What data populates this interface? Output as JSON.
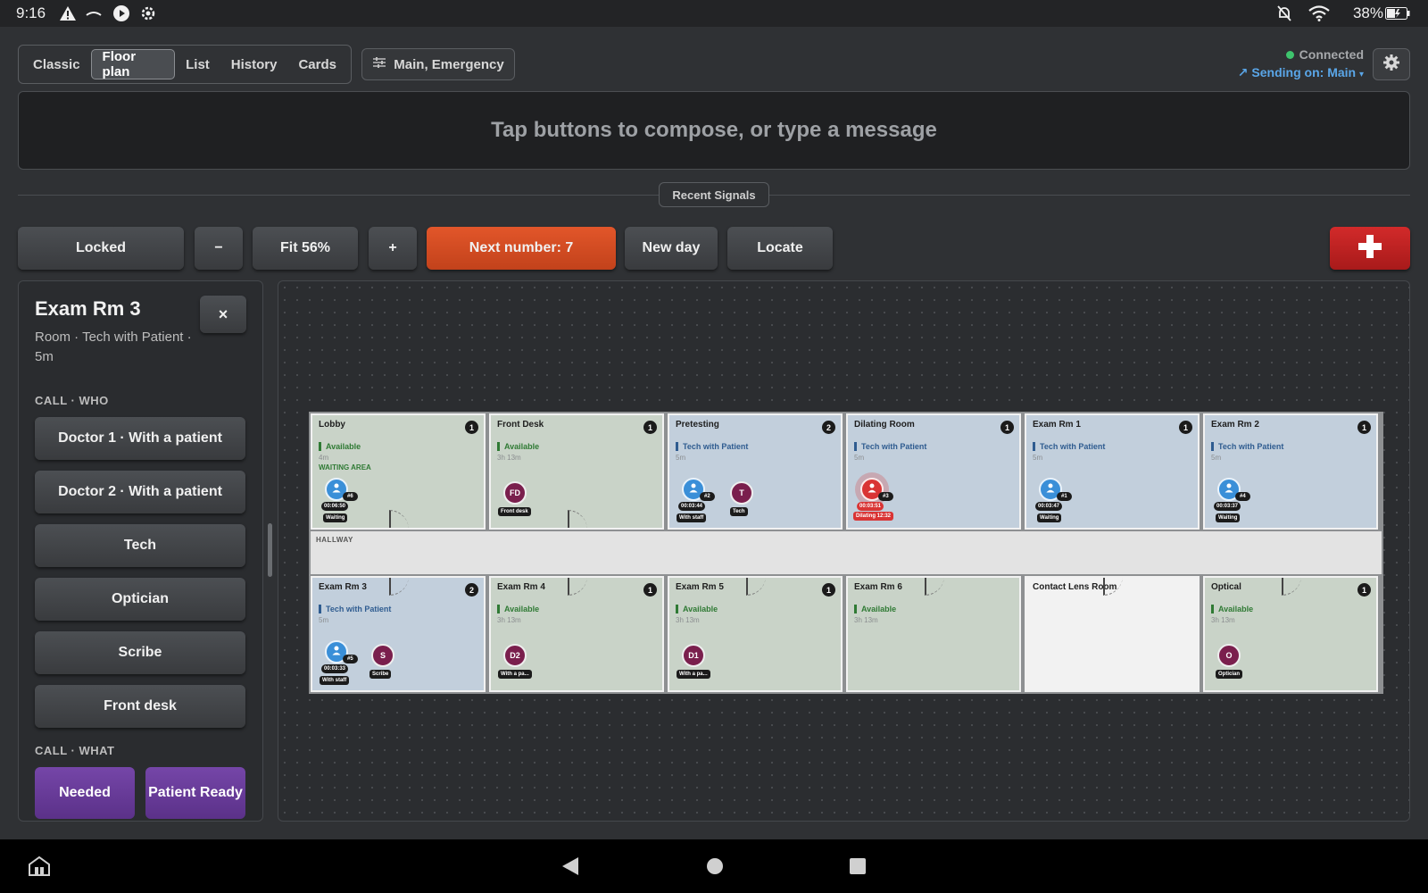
{
  "status_bar": {
    "time": "9:16",
    "battery": "38%"
  },
  "tabs": [
    {
      "label": "Classic",
      "active": false
    },
    {
      "label": "Floor plan",
      "active": true
    },
    {
      "label": "List",
      "active": false
    },
    {
      "label": "History",
      "active": false
    },
    {
      "label": "Cards",
      "active": false
    }
  ],
  "filter": {
    "label": "Main, Emergency"
  },
  "connection": {
    "status": "Connected",
    "sending": "Sending on: Main"
  },
  "composer": {
    "placeholder": "Tap buttons to compose, or type a message"
  },
  "recent_signals": "Recent Signals",
  "toolbar": {
    "locked": "Locked",
    "minus": "−",
    "fit": "Fit 56%",
    "plus": "+",
    "next_number": "Next number: 7",
    "new_day": "New day",
    "locate": "Locate",
    "emergency": "+"
  },
  "side_panel": {
    "title": "Exam Rm 3",
    "subtitle": "Room · Tech with Patient · 5m",
    "close": "×",
    "who_label": "CALL · WHO",
    "who_buttons": [
      "Doctor 1 · With a patient",
      "Doctor 2 · With a patient",
      "Tech",
      "Optician",
      "Scribe",
      "Front desk"
    ],
    "what_label": "CALL · WHAT",
    "what_buttons": [
      "Needed",
      "Patient Ready"
    ]
  },
  "floor": {
    "hallway": "HALLWAY",
    "rooms": [
      {
        "name": "Lobby",
        "count": "1",
        "status": "Available",
        "time": "4m",
        "area": "WAITING AREA"
      },
      {
        "name": "Front Desk",
        "count": "1",
        "status": "Available",
        "time": "3h 13m"
      },
      {
        "name": "Pretesting",
        "count": "2",
        "status": "Tech with Patient",
        "time": "5m"
      },
      {
        "name": "Dilating Room",
        "count": "1",
        "status": "Tech with Patient",
        "time": "5m"
      },
      {
        "name": "Exam Rm 1",
        "count": "1",
        "status": "Tech with Patient",
        "time": "5m"
      },
      {
        "name": "Exam Rm 2",
        "count": "1",
        "status": "Tech with Patient",
        "time": "5m"
      },
      {
        "name": "Exam Rm 3",
        "count": "2",
        "status": "Tech with Patient",
        "time": "5m"
      },
      {
        "name": "Exam Rm 4",
        "count": "1",
        "status": "Available",
        "time": "3h 13m"
      },
      {
        "name": "Exam Rm 5",
        "count": "1",
        "status": "Available",
        "time": "3h 13m"
      },
      {
        "name": "Exam Rm 6",
        "status": "Available",
        "time": "3h 13m"
      },
      {
        "name": "Contact Lens Room"
      },
      {
        "name": "Optical",
        "count": "1",
        "status": "Available",
        "time": "3h 13m"
      }
    ],
    "patients": {
      "lobby": {
        "num": "#6",
        "timer": "00:06:50",
        "tag": "Waiting"
      },
      "pretesting": {
        "num": "#2",
        "timer": "00:03:44",
        "tag": "With staff"
      },
      "dilating": {
        "num": "#3",
        "timer": "00:03:51",
        "tag": "Dilating 12:32"
      },
      "exam1": {
        "num": "#1",
        "timer": "00:03:47",
        "tag": "Waiting"
      },
      "exam2": {
        "num": "#4",
        "timer": "00:03:37",
        "tag": "Waiting"
      },
      "exam3": {
        "num": "#5",
        "timer": "00:03:33",
        "tag": "With staff"
      }
    },
    "staff": {
      "front_desk": {
        "initials": "FD",
        "tag": "Front desk"
      },
      "pretesting": {
        "initials": "T",
        "tag": "Tech"
      },
      "exam3": {
        "initials": "S",
        "tag": "Scribe"
      },
      "exam4": {
        "initials": "D2",
        "tag": "With a pa..."
      },
      "exam5": {
        "initials": "D1",
        "tag": "With a pa..."
      },
      "optical": {
        "initials": "O",
        "tag": "Optician"
      }
    }
  },
  "colors": {
    "accent_orange": "#d94e22",
    "emergency_red": "#c42020",
    "purple": "#6a3b9c",
    "room_green": "#c9d3c8",
    "room_blue": "#c2cfdc",
    "patient_blue": "#3a8fd8",
    "connected_green": "#3ec46d"
  }
}
